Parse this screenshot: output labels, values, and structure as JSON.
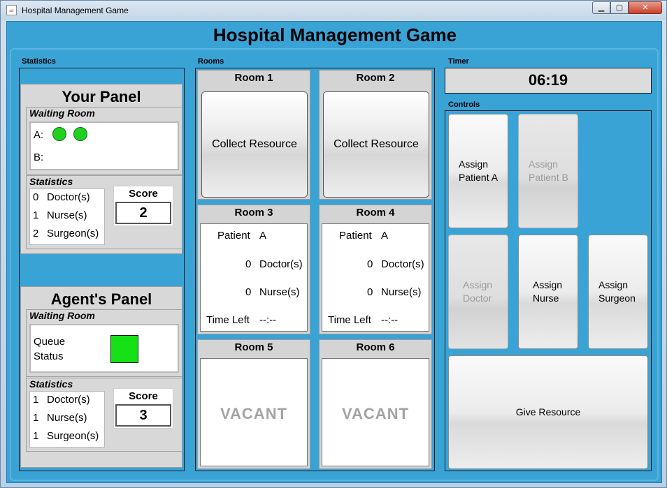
{
  "window": {
    "title": "Hospital Management Game",
    "icon": "java-cup-icon"
  },
  "main_title": "Hospital Management Game",
  "sections": {
    "statistics": "Statistics",
    "rooms": "Rooms",
    "timer": "Timer",
    "controls": "Controls"
  },
  "your_panel": {
    "title": "Your Panel",
    "waiting_room_label": "Waiting Room",
    "queue_a_label": "A:",
    "queue_a_patients": 2,
    "queue_b_label": "B:",
    "statistics_label": "Statistics",
    "stats": [
      {
        "count": "0",
        "label": "Doctor(s)"
      },
      {
        "count": "1",
        "label": "Nurse(s)"
      },
      {
        "count": "2",
        "label": "Surgeon(s)"
      }
    ],
    "score_label": "Score",
    "score": "2"
  },
  "agent_panel": {
    "title": "Agent's Panel",
    "waiting_room_label": "Waiting Room",
    "queue_status_line1": "Queue",
    "queue_status_line2": "Status",
    "queue_status_color": "#16e016",
    "statistics_label": "Statistics",
    "stats": [
      {
        "count": "1",
        "label": "Doctor(s)"
      },
      {
        "count": "1",
        "label": "Nurse(s)"
      },
      {
        "count": "1",
        "label": "Surgeon(s)"
      }
    ],
    "score_label": "Score",
    "score": "3"
  },
  "rooms": [
    {
      "name": "Room  1",
      "button": "Collect Resource"
    },
    {
      "name": "Room  2",
      "button": "Collect Resource"
    },
    {
      "name": "Room  3",
      "patient_label": "Patient",
      "patient": "A",
      "doctors": "0",
      "doctors_label": "Doctor(s)",
      "nurses": "0",
      "nurses_label": "Nurse(s)",
      "time_left_label": "Time Left",
      "time_left": "--:--"
    },
    {
      "name": "Room  4",
      "patient_label": "Patient",
      "patient": "A",
      "doctors": "0",
      "doctors_label": "Doctor(s)",
      "nurses": "0",
      "nurses_label": "Nurse(s)",
      "time_left_label": "Time Left",
      "time_left": "--:--"
    },
    {
      "name": "Room  5",
      "status": "VACANT"
    },
    {
      "name": "Room  6",
      "status": "VACANT"
    }
  ],
  "timer": {
    "value": "06:19"
  },
  "controls": {
    "assign_patient_a": {
      "line1": "Assign",
      "line2": "Patient A",
      "enabled": true
    },
    "assign_patient_b": {
      "line1": "Assign",
      "line2": "Patient B",
      "enabled": false
    },
    "assign_doctor": {
      "line1": "Assign",
      "line2": "Doctor",
      "enabled": false
    },
    "assign_nurse": {
      "line1": "Assign",
      "line2": "Nurse",
      "enabled": true
    },
    "assign_surgeon": {
      "line1": "Assign",
      "line2": "Surgeon",
      "enabled": true
    },
    "give_resource": {
      "label": "Give Resource",
      "enabled": true
    }
  },
  "colors": {
    "background": "#3aa3d6",
    "patient_dot": "#1ed21e",
    "vacant_text": "#a3a3a3"
  }
}
